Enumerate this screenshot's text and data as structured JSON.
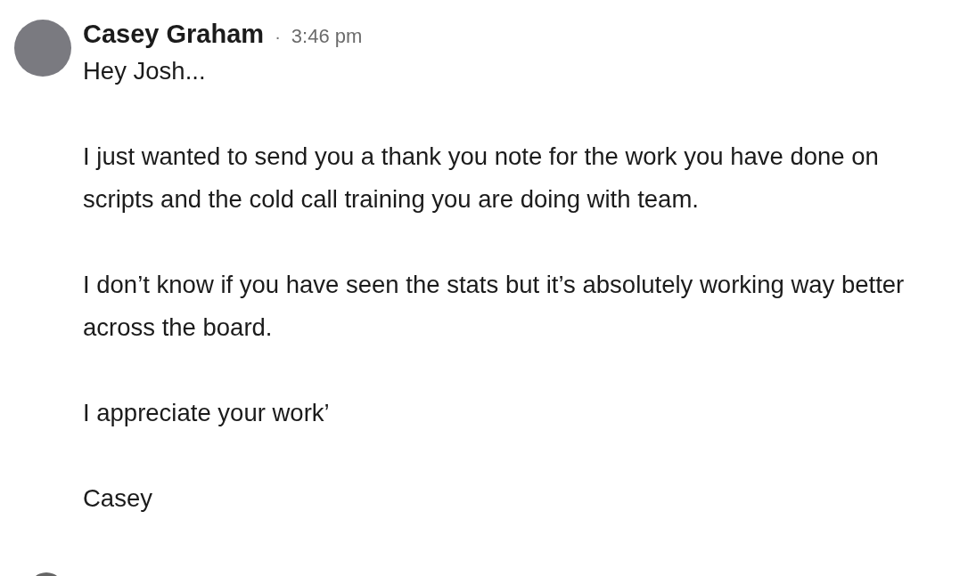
{
  "message": {
    "sender": "Casey Graham",
    "separator": "·",
    "time": "3:46 pm",
    "paragraphs": [
      "Hey Josh...",
      "I just wanted to send you a thank you note for the work you have done on scripts and the cold call training you are doing with team.",
      "I don’t know if you have seen the stats but it’s absolutely working way better across the board.",
      "I appreciate your work’",
      "Casey"
    ]
  }
}
